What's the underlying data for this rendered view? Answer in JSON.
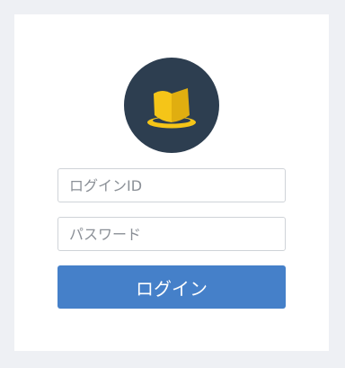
{
  "logo": {
    "icon": "top-hat-icon",
    "bg_color": "#2d3e50",
    "accent_color": "#f5c518"
  },
  "form": {
    "login_id_placeholder": "ログインID",
    "password_placeholder": "パスワード",
    "submit_label": "ログイン",
    "button_color": "#4580c9"
  }
}
